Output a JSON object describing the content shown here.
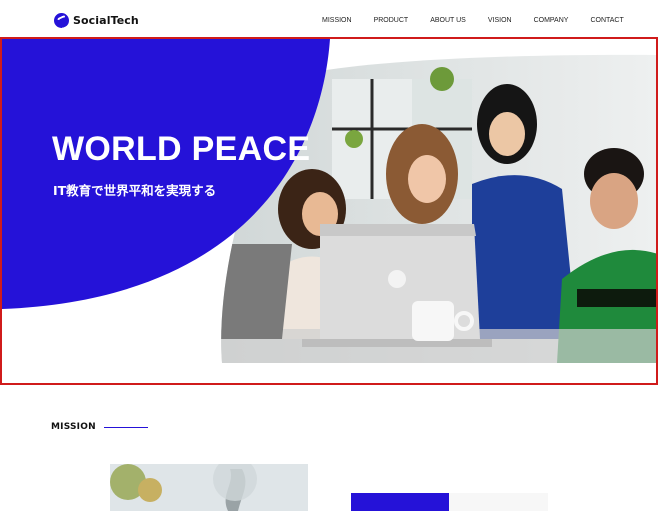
{
  "header": {
    "logo_text": "SocialTech",
    "nav": [
      "MISSION",
      "PRODUCT",
      "ABOUT US",
      "VISION",
      "COMPANY",
      "CONTACT"
    ]
  },
  "hero": {
    "title": "WORLD PEACE",
    "subtitle": "IT教育で世界平和を実現する"
  },
  "mission": {
    "label": "MISSION"
  },
  "colors": {
    "brand_blue": "#2512d8",
    "highlight_border": "#d01b1b"
  },
  "icons": {
    "logo": "socialtech-logo-icon"
  }
}
